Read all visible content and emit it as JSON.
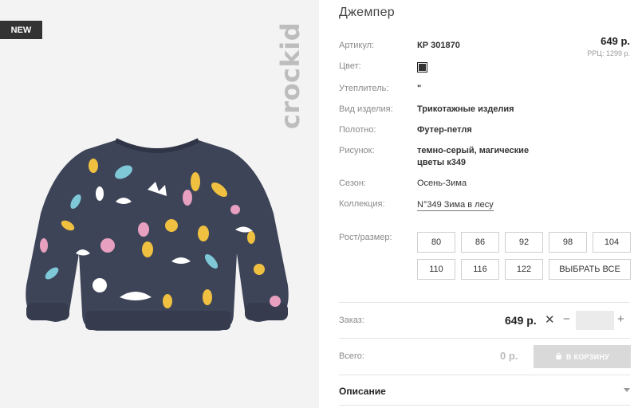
{
  "badge": "NEW",
  "brand": "crockid",
  "product": {
    "title": "Джемпер",
    "price": "649 р.",
    "rrp": "РРЦ: 1299 р."
  },
  "attributes": {
    "article_label": "Артикул:",
    "article_value": "КР 301870",
    "color_label": "Цвет:",
    "color_swatch": "#333333",
    "insulation_label": "Утеплитель:",
    "insulation_value": "\"",
    "type_label": "Вид изделия:",
    "type_value": "Трикотажные изделия",
    "fabric_label": "Полотно:",
    "fabric_value": "Футер-петля",
    "pattern_label": "Рисунок:",
    "pattern_line1": "темно-серый, магические",
    "pattern_line2": "цветы к349",
    "season_label": "Сезон:",
    "season_value": "Осень-Зима",
    "collection_label": "Коллекция:",
    "collection_value": "N°349 Зима в лесу"
  },
  "sizes": {
    "label": "Рост/размер:",
    "options": [
      "80",
      "86",
      "92",
      "98",
      "104",
      "110",
      "116",
      "122"
    ],
    "select_all": "ВЫБРАТЬ ВСЕ"
  },
  "order": {
    "label": "Заказ:",
    "price": "649 р.",
    "times": "✕",
    "minus": "−",
    "plus": "+",
    "quantity": ""
  },
  "total": {
    "label": "Всего:",
    "value": "0 р.",
    "cart_button": "В КОРЗИНУ",
    "cart_icon": "cart-icon"
  },
  "description": {
    "label": "Описание",
    "icon": "chevron-down-icon"
  }
}
